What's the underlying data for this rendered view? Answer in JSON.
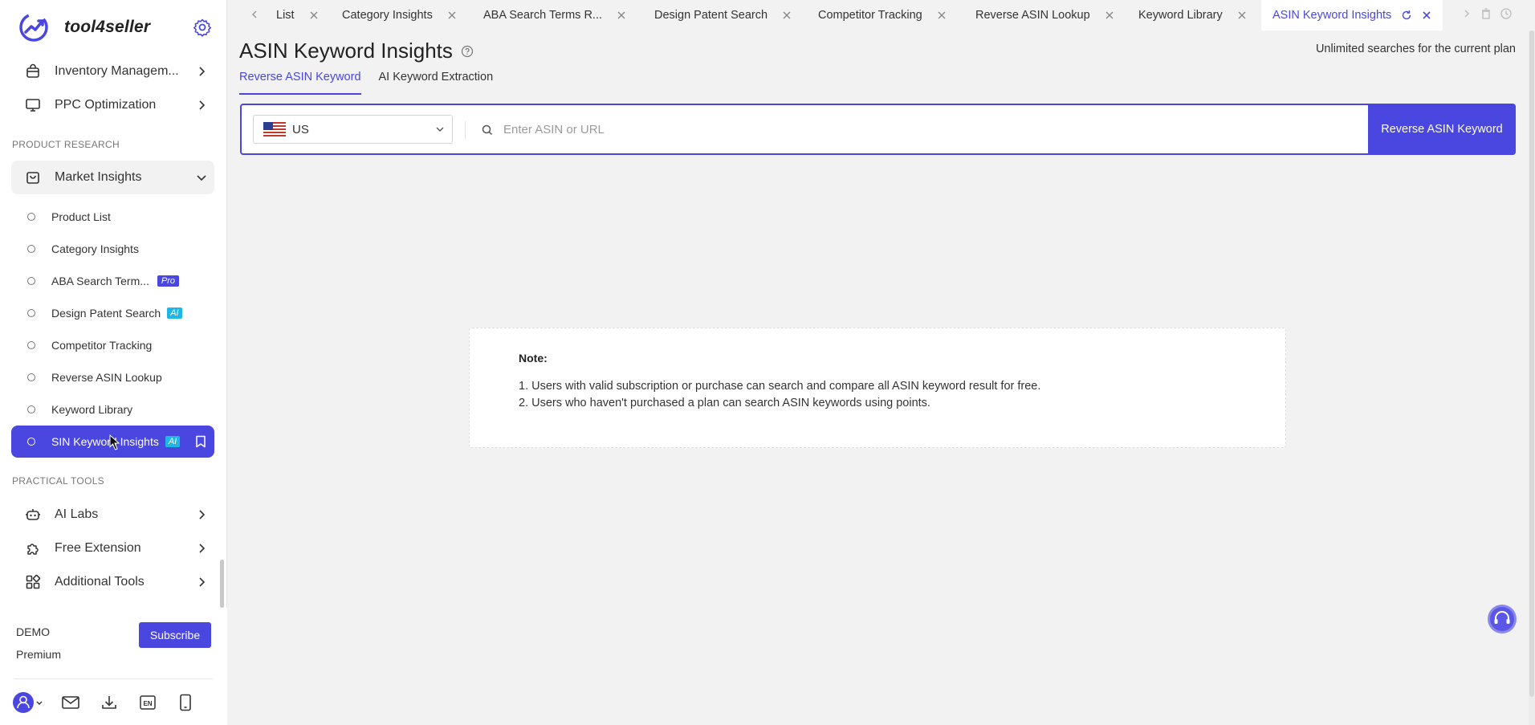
{
  "app": {
    "name": "tool4seller"
  },
  "sidebar": {
    "top_items": [
      {
        "label": "Inventory Managem...",
        "icon": "inventory-icon"
      },
      {
        "label": "PPC Optimization",
        "icon": "monitor-icon"
      }
    ],
    "section_product_research": "PRODUCT RESEARCH",
    "market_insights": {
      "label": "Market Insights",
      "icon": "shopping-bag-icon"
    },
    "sub_items": [
      {
        "label": "Product List"
      },
      {
        "label": "Category Insights"
      },
      {
        "label": "ABA Search Term...",
        "badge": "Pro"
      },
      {
        "label": "Design Patent Search",
        "badge": "AI"
      },
      {
        "label": "Competitor Tracking"
      },
      {
        "label": "Reverse ASIN Lookup"
      },
      {
        "label": "Keyword Library"
      },
      {
        "label": "SIN Keyword Insights",
        "badge": "AI",
        "active": true
      }
    ],
    "section_practical_tools": "PRACTICAL TOOLS",
    "bottom_items": [
      {
        "label": "AI Labs",
        "icon": "robot-icon"
      },
      {
        "label": "Free Extension",
        "icon": "puzzle-icon"
      },
      {
        "label": "Additional Tools",
        "icon": "grid-icon"
      }
    ],
    "plan": {
      "account": "DEMO",
      "tier": "Premium",
      "subscribe_label": "Subscribe"
    },
    "footer_icons": [
      "user-icon",
      "mail-icon",
      "download-icon",
      "language-en-icon",
      "mobile-icon"
    ]
  },
  "tabs": [
    {
      "label": "List"
    },
    {
      "label": "Category Insights"
    },
    {
      "label": "ABA Search Terms R..."
    },
    {
      "label": "Design Patent Search"
    },
    {
      "label": "Competitor Tracking"
    },
    {
      "label": "Reverse ASIN Lookup"
    },
    {
      "label": "Keyword Library"
    },
    {
      "label": "ASIN Keyword Insights",
      "active": true
    }
  ],
  "main": {
    "title": "ASIN Keyword Insights",
    "plan_note": "Unlimited searches for the current plan",
    "subtabs": [
      {
        "label": "Reverse ASIN Keyword",
        "active": true
      },
      {
        "label": "AI Keyword Extraction"
      }
    ],
    "search": {
      "country": "US",
      "placeholder": "Enter ASIN or URL",
      "button_label": "Reverse ASIN Keyword"
    },
    "note": {
      "title": "Note:",
      "lines": [
        "1. Users with valid subscription or purchase can search and compare all ASIN keyword result for free.",
        "2. Users who haven't purchased a plan can search ASIN keywords using points."
      ]
    }
  },
  "colors": {
    "accent": "#4a47e0",
    "ai_badge": "#1fb8e6",
    "background": "#f2f2f2"
  }
}
